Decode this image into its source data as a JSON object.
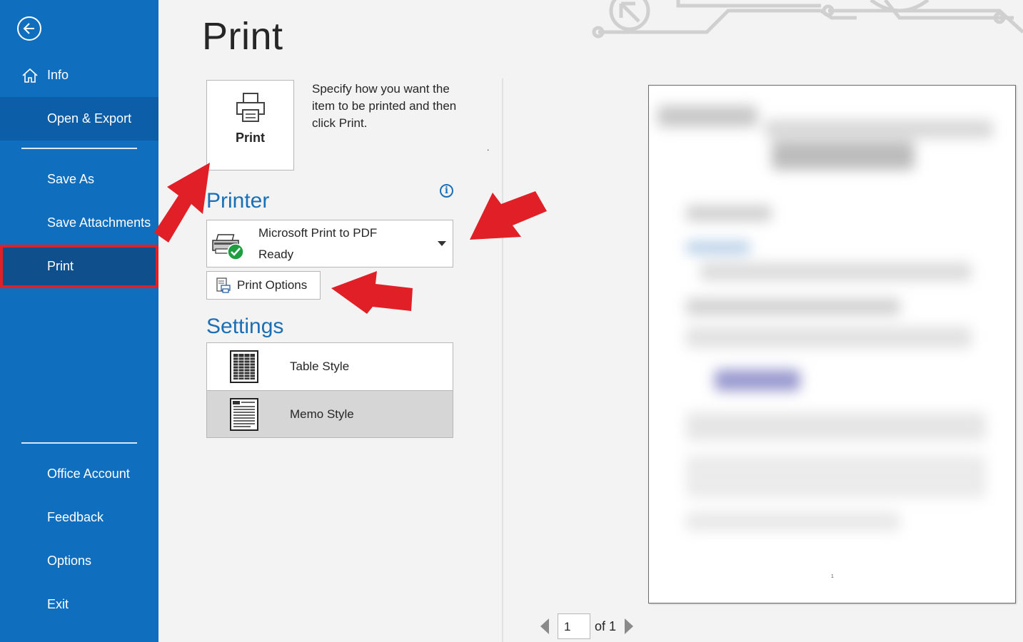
{
  "sidebar": {
    "info": "Info",
    "open_export": "Open & Export",
    "save_as": "Save As",
    "save_attachments": "Save Attachments",
    "print": "Print",
    "office_account": "Office Account",
    "feedback": "Feedback",
    "options": "Options",
    "exit": "Exit"
  },
  "main": {
    "title": "Print",
    "print_button_label": "Print",
    "description": "Specify how you want the item to be printed and then click Print.",
    "description_dot": ".",
    "printer_section": "Printer",
    "printer": {
      "name": "Microsoft Print to PDF",
      "status": "Ready"
    },
    "print_options_label": "Print Options",
    "settings_section": "Settings",
    "styles": [
      {
        "label": "Table Style",
        "selected": false
      },
      {
        "label": "Memo Style",
        "selected": true
      }
    ]
  },
  "preview": {
    "page_mark": "1",
    "current_page": "1",
    "total_pages_text": "of 1"
  },
  "colors": {
    "sidebar_bg": "#106ebe",
    "accent": "#1a6fb5",
    "highlight": "#e01f26"
  }
}
